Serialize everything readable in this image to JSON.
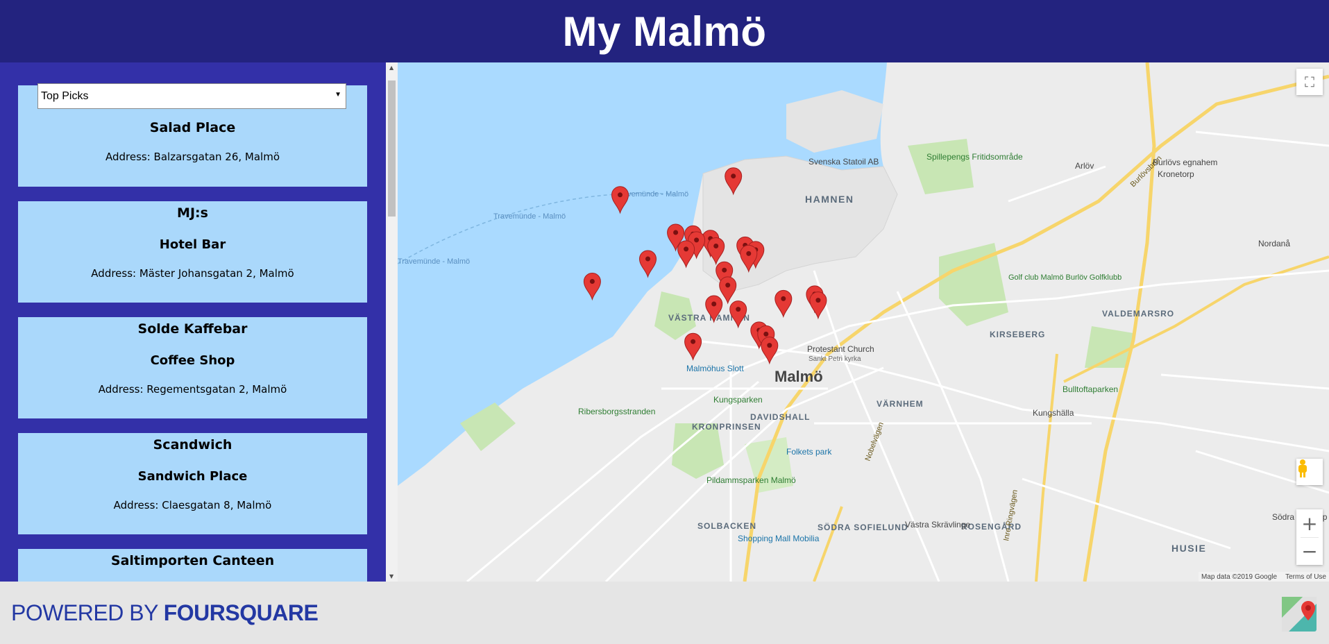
{
  "header": {
    "title": "My Malmö"
  },
  "filter": {
    "selected": "Top Picks"
  },
  "venues": [
    {
      "name": "Salad Place",
      "category": "",
      "address": "Address: Balzarsgatan 26, Malmö"
    },
    {
      "name": "MJ:s",
      "category": "Hotel Bar",
      "address": "Address: Mäster Johansgatan 2, Malmö"
    },
    {
      "name": "Solde Kaffebar",
      "category": "Coffee Shop",
      "address": "Address: Regementsgatan 2, Malmö"
    },
    {
      "name": "Scandwich",
      "category": "Sandwich Place",
      "address": "Address: Claesgatan 8, Malmö"
    },
    {
      "name": "Saltimporten Canteen",
      "category": "",
      "address": ""
    }
  ],
  "map": {
    "labels": {
      "hamnen": "HAMNEN",
      "vastra_hamnen": "VÄSTRA HAMNEN",
      "malmo": "Malmö",
      "kungsparken": "Kungsparken",
      "davidshall": "DAVIDSHALL",
      "kronprinsen": "KRONPRINSEN",
      "ribersborg": "Ribersborgsstranden",
      "malmohus": "Malmöhus Slott",
      "pildammsparken": "Pildammsparken Malmö",
      "solbacken": "SOLBACKEN",
      "sodra_sofielund": "SÖDRA SOFIELUND",
      "varnhem": "VÄRNHEM",
      "kirseberg": "KIRSEBERG",
      "valdemarsro": "VALDEMARSRO",
      "bulltoftaparken": "Bulltoftaparken",
      "kungshalla": "Kungshälla",
      "husie": "HUSIE",
      "rosengard": "ROSENGÅRD",
      "vastra_skravlinge": "Västra Skrävlinge",
      "sodra_sallerup": "Södra Sallerup",
      "nordana": "Nordanå",
      "arlov": "Arlöv",
      "burlovs": "Burlövs egnahem",
      "kronetorp": "Kronetorp",
      "spillepeng": "Spillepengs Fritidsområde",
      "statoil": "Svenska Statoil AB",
      "golf": "Golf club Malmö Burlöv Golfklubb",
      "protestant": "Protestant Church",
      "sankt_petri": "Sankt Petri kyrka",
      "folkets_park": "Folkets park",
      "shopping_mall": "Shopping Mall Mobilia",
      "ferry1": "Travemünde - Malmö",
      "ferry2": "Travemünde - Malmö",
      "ferry3": "Travemünde - Malmö",
      "nobelvagen": "Nobelvägen",
      "inre_ringvagen": "Inre Ringvägen",
      "burlovsbron": "Burlövsbron"
    },
    "markers": [
      {
        "lat": 55.6155,
        "lng": 13.0043
      },
      {
        "lat": 55.613,
        "lng": 12.988
      },
      {
        "lat": 55.608,
        "lng": 12.996
      },
      {
        "lat": 55.6078,
        "lng": 12.9985
      },
      {
        "lat": 55.6072,
        "lng": 13.001
      },
      {
        "lat": 55.607,
        "lng": 12.999
      },
      {
        "lat": 55.6062,
        "lng": 13.0018
      },
      {
        "lat": 55.6058,
        "lng": 12.9975
      },
      {
        "lat": 55.6063,
        "lng": 13.006
      },
      {
        "lat": 55.6057,
        "lng": 13.0075
      },
      {
        "lat": 55.6052,
        "lng": 13.0065
      },
      {
        "lat": 55.6045,
        "lng": 12.992
      },
      {
        "lat": 55.603,
        "lng": 13.003
      },
      {
        "lat": 55.6015,
        "lng": 12.984
      },
      {
        "lat": 55.601,
        "lng": 13.0035
      },
      {
        "lat": 55.5998,
        "lng": 13.016
      },
      {
        "lat": 55.5992,
        "lng": 13.0115
      },
      {
        "lat": 55.599,
        "lng": 13.0165
      },
      {
        "lat": 55.5985,
        "lng": 13.0015
      },
      {
        "lat": 55.5978,
        "lng": 13.005
      },
      {
        "lat": 55.595,
        "lng": 13.008
      },
      {
        "lat": 55.5945,
        "lng": 13.009
      },
      {
        "lat": 55.5935,
        "lng": 12.9985
      },
      {
        "lat": 55.593,
        "lng": 13.0095
      }
    ],
    "attribution": {
      "data": "Map data ©2019 Google",
      "terms": "Terms of Use"
    }
  },
  "footer": {
    "powered_by": "POWERED BY",
    "brand": "FOURSQUARE"
  },
  "colors": {
    "header": "#23237f",
    "sidebar": "#3330a8",
    "card": "#aad8fb",
    "water": "#aadaff",
    "marker": "#e53935"
  }
}
